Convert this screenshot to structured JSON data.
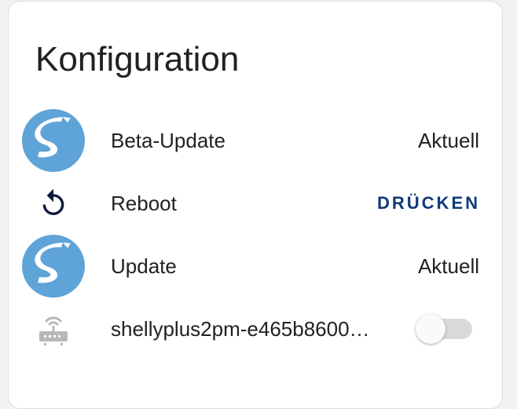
{
  "card": {
    "title": "Konfiguration"
  },
  "rows": [
    {
      "icon": "shelly-logo-icon",
      "label": "Beta-Update",
      "value": "Aktuell"
    },
    {
      "icon": "restart-icon",
      "label": "Reboot",
      "action_label": "DRÜCKEN"
    },
    {
      "icon": "shelly-logo-icon",
      "label": "Update",
      "value": "Aktuell"
    },
    {
      "icon": "router-wifi-icon",
      "label": "shellyplus2pm-e465b8600…",
      "toggle_on": false
    }
  ],
  "colors": {
    "accent": "#0d3b7a",
    "logo": "#5ea4d8",
    "icon_dark": "#0c1a3c",
    "icon_muted": "#b8b8b8",
    "text": "#212121",
    "toggle_track_off": "#d9d9d9"
  }
}
